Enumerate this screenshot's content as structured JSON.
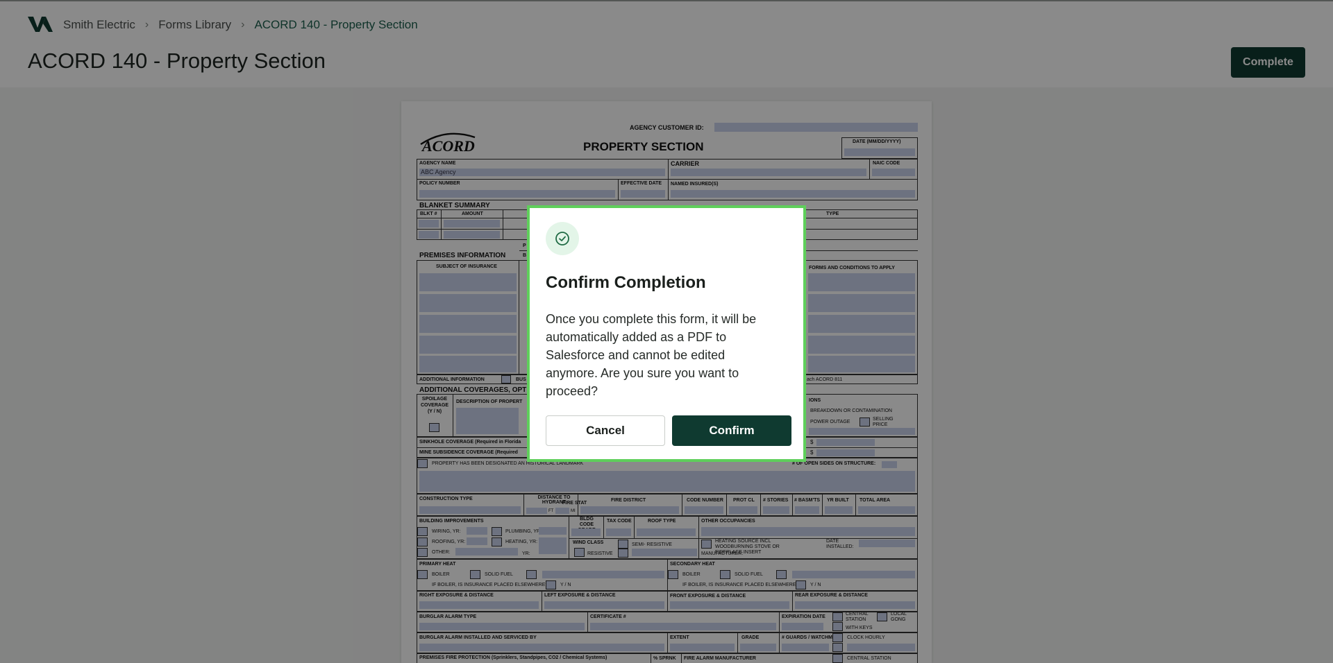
{
  "header": {
    "logo_icon": "brand-logo-icon",
    "breadcrumb": {
      "home": "Smith Electric",
      "library": "Forms Library",
      "current": "ACORD 140 - Property Section",
      "separator_icon": "chevron-right-icon"
    },
    "title": "ACORD 140 - Property Section",
    "complete_label": "Complete"
  },
  "form": {
    "agency_customer_id_label": "AGENCY CUSTOMER ID:",
    "logo_text": "ACORD",
    "title": "PROPERTY SECTION",
    "date_label": "DATE (MM/DD/YYYY)",
    "agency_name_label": "AGENCY NAME",
    "agency_name_value": "ABC Agency",
    "carrier_label": "CARRIER",
    "naic_code_label": "NAIC CODE",
    "policy_number_label": "POLICY NUMBER",
    "effective_date_label": "EFFECTIVE DATE",
    "named_insured_label": "NAMED INSURED(S)",
    "blanket_summary_label": "BLANKET SUMMARY",
    "blkt_label": "BLKT #",
    "amount_label": "AMOUNT",
    "type_label": "TYPE",
    "premises_info_label": "PREMISES INFORMATION",
    "subject_label": "SUBJECT OF INSURANCE",
    "forms_conditions_label": "FORMS AND CONDITIONS TO APPLY",
    "additional_info_label": "ADDITIONAL INFORMATION",
    "bus_fragment": "BUS",
    "attach_fragment": "ach ACORD 811",
    "additional_coverages_label": "ADDITIONAL COVERAGES, OPT",
    "spoilage_label": "SPOILAGE COVERAGE (Y / N)",
    "desc_property_label": "DESCRIPTION OF PROPERT",
    "options_fragment": "IONS",
    "breakdown_label": "BREAKDOWN OR CONTAMINATION",
    "power_outage_label": "POWER OUTAGE",
    "selling_price_label": "SELLING PRICE",
    "sinkhole_label": "SINKHOLE COVERAGE (Required in Florida",
    "mine_label": "MINE SUBSIDENCE COVERAGE (Required",
    "historical_label": "PROPERTY HAS BEEN DESIGNATED AN HISTORICAL LANDMARK",
    "open_sides_label": "# OF OPEN SIDES ON STRUCTURE:",
    "construction_type_label": "CONSTRUCTION TYPE",
    "distance_hydrant_label": "DISTANCE TO HYDRANT",
    "distance_station_label": "FIRE STAT",
    "ft_label": "FT",
    "mi_label": "MI",
    "fire_district_label": "FIRE DISTRICT",
    "code_number_label": "CODE NUMBER",
    "prot_cl_label": "PROT CL",
    "stories_label": "# STORIES",
    "basmts_label": "# BASM'TS",
    "yr_built_label": "YR BUILT",
    "total_area_label": "TOTAL AREA",
    "building_improvements_label": "BUILDING IMPROVEMENTS",
    "wiring_label": "WIRING, YR:",
    "roofing_label": "ROOFING, YR:",
    "other_label": "OTHER:",
    "plumbing_label": "PLUMBING, YR:",
    "heating_label": "HEATING, YR:",
    "yr_label": "YR:",
    "bldg_code_label": "BLDG CODE GRADE",
    "tax_code_label": "TAX CODE",
    "roof_type_label": "ROOF TYPE",
    "other_occupancies_label": "OTHER OCCUPANCIES",
    "wind_class_label": "WIND CLASS",
    "resistive_label": "RESISTIVE",
    "semi_resistive_label": "SEMI- RESISTIVE",
    "heating_source_label": "HEATING SOURCE INCL WOODBURNING STOVE OR FIREPLACE INSERT",
    "date_installed_label": "DATE INSTALLED:",
    "manufacturer_label": "MANUFACTURER:",
    "primary_heat_label": "PRIMARY HEAT",
    "secondary_heat_label": "SECONDARY HEAT",
    "boiler_label": "BOILER",
    "solid_fuel_label": "SOLID FUEL",
    "boiler_insurance_label": "IF BOILER, IS INSURANCE PLACED ELSEWHERE?",
    "yn_label": "Y / N",
    "right_exposure_label": "RIGHT EXPOSURE & DISTANCE",
    "left_exposure_label": "LEFT EXPOSURE & DISTANCE",
    "front_exposure_label": "FRONT EXPOSURE & DISTANCE",
    "rear_exposure_label": "REAR EXPOSURE & DISTANCE",
    "burglar_alarm_type_label": "BURGLAR ALARM TYPE",
    "certificate_label": "CERTIFICATE #",
    "expiration_date_label": "EXPIRATION DATE",
    "central_station_label": "CENTRAL STATION",
    "local_gong_label": "LOCAL GONG",
    "with_keys_label": "WITH KEYS",
    "burglar_installed_label": "BURGLAR ALARM INSTALLED AND SERVICED BY",
    "extent_label": "EXTENT",
    "grade_label": "GRADE",
    "guards_label": "# GUARDS / WATCHMEN",
    "clock_hourly_label": "CLOCK HOURLY",
    "fire_protection_label": "PREMISES FIRE PROTECTION (Sprinklers, Standpipes, CO2 / Chemical Systems)",
    "sprnk_label": "% SPRNK",
    "fire_alarm_mfr_label": "FIRE ALARM MANUFACTURER",
    "central_station_2_label": "CENTRAL STATION",
    "partial_p": "P",
    "partial_b": "B"
  },
  "modal": {
    "icon": "check-circle-icon",
    "title": "Confirm Completion",
    "body": "Once you complete this form, it will be automatically added as a PDF to Salesforce and cannot be edited anymore. Are you sure you want to proceed?",
    "cancel_label": "Cancel",
    "confirm_label": "Confirm"
  },
  "colors": {
    "primary": "#0f3a30",
    "accent_link": "#1b5e4c",
    "modal_border": "#5fcf5b",
    "form_field": "#c9d2ec"
  }
}
